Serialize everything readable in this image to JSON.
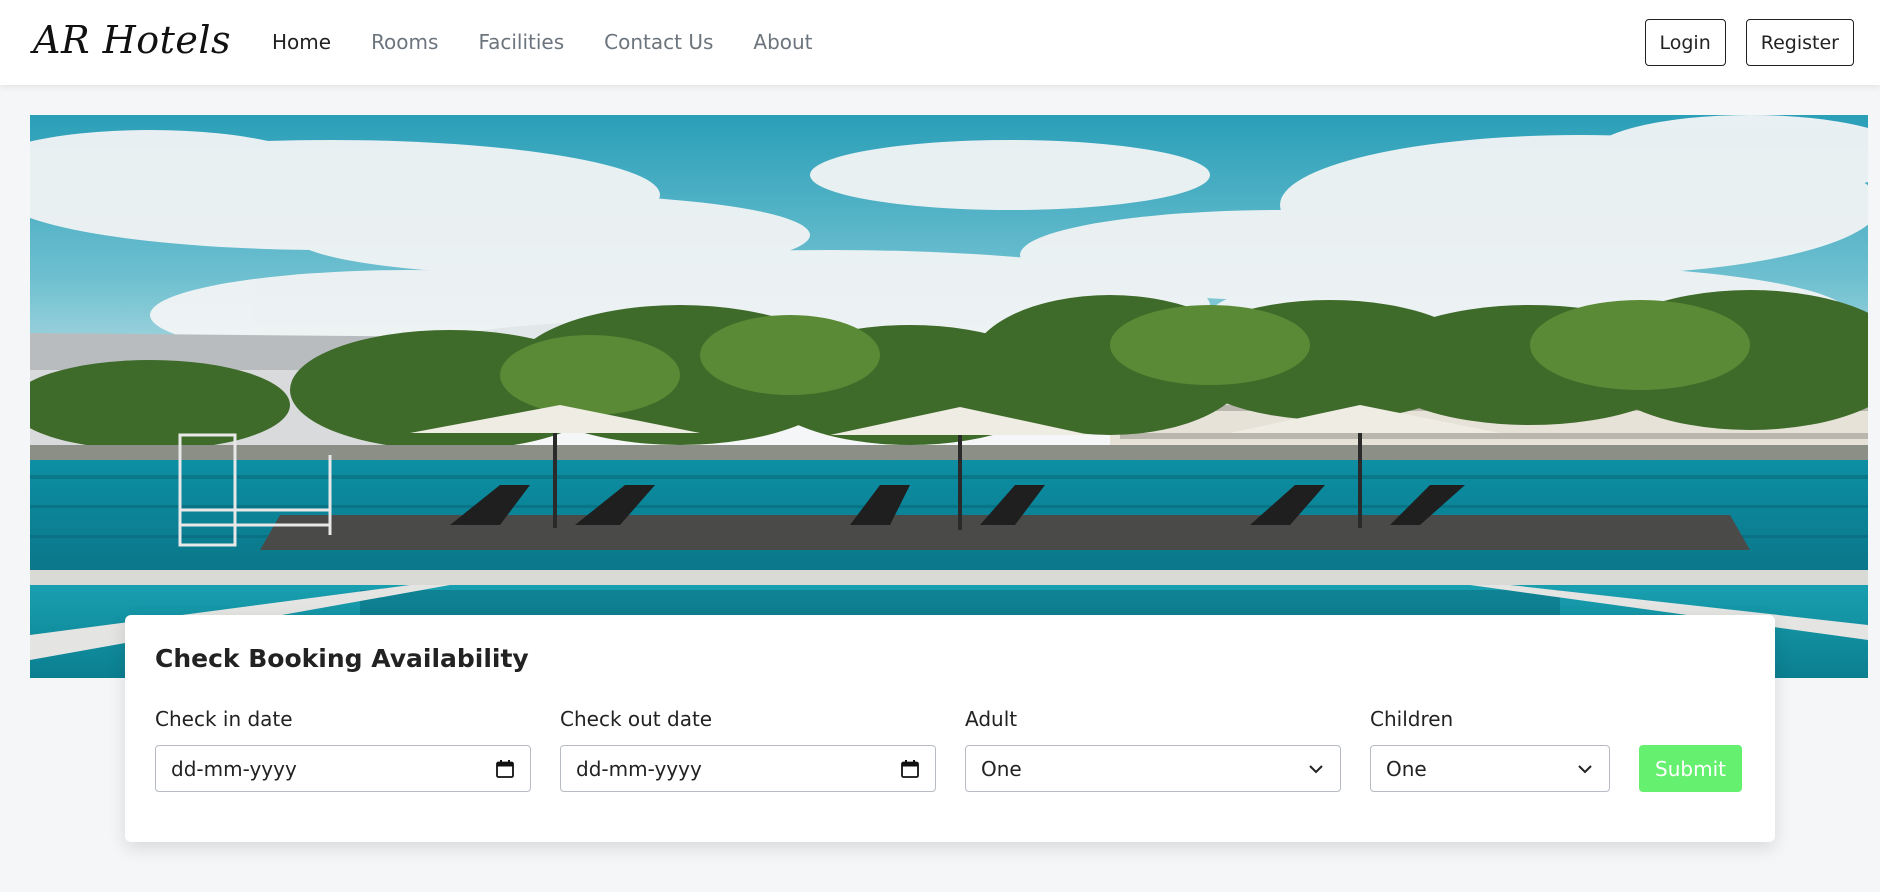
{
  "brand": "AR Hotels",
  "nav": {
    "home": "Home",
    "rooms": "Rooms",
    "facilities": "Facilities",
    "contact": "Contact Us",
    "about": "About"
  },
  "auth": {
    "login": "Login",
    "register": "Register"
  },
  "hero": {
    "icon": "hotel-pool-photo"
  },
  "booking": {
    "title": "Check Booking Availability",
    "checkin_label": "Check in date",
    "checkin_placeholder": "dd-mm-yyyy",
    "checkout_label": "Check out date",
    "checkout_placeholder": "dd-mm-yyyy",
    "adult_label": "Adult",
    "adult_value": "One",
    "children_label": "Children",
    "children_value": "One",
    "submit": "Submit"
  },
  "colors": {
    "accent": "#66f06f",
    "page_bg": "#f5f6f8"
  }
}
